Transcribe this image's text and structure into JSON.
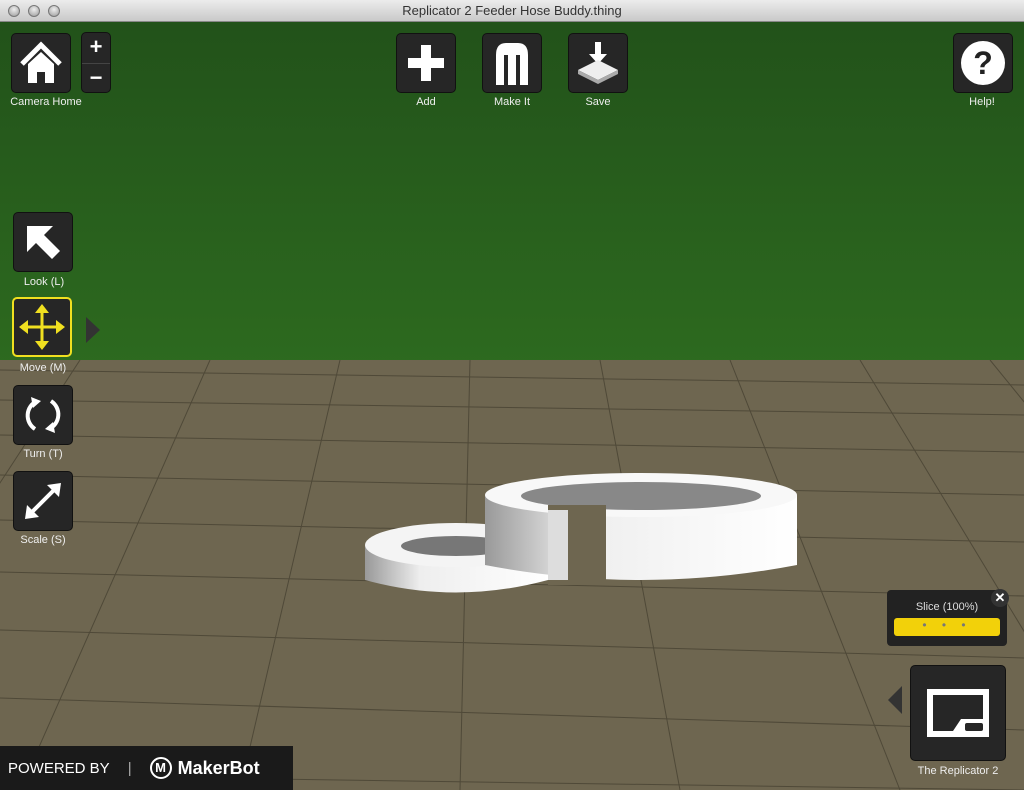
{
  "window": {
    "title": "Replicator 2 Feeder Hose Buddy.thing"
  },
  "toolbar": {
    "camera_home": "Camera Home",
    "zoom_in": "+",
    "zoom_out": "−",
    "add": "Add",
    "make_it": "Make It",
    "save": "Save",
    "help": "Help!"
  },
  "tools": {
    "look": "Look (L)",
    "move": "Move (M)",
    "turn": "Turn (T)",
    "scale": "Scale (S)"
  },
  "slice": {
    "label": "Slice (100%)",
    "progress_percent": 100,
    "dots": "• • •",
    "close": "✕"
  },
  "printer": {
    "label": "The Replicator 2"
  },
  "branding": {
    "powered_by": "POWERED BY",
    "brand": "MakerBot"
  }
}
